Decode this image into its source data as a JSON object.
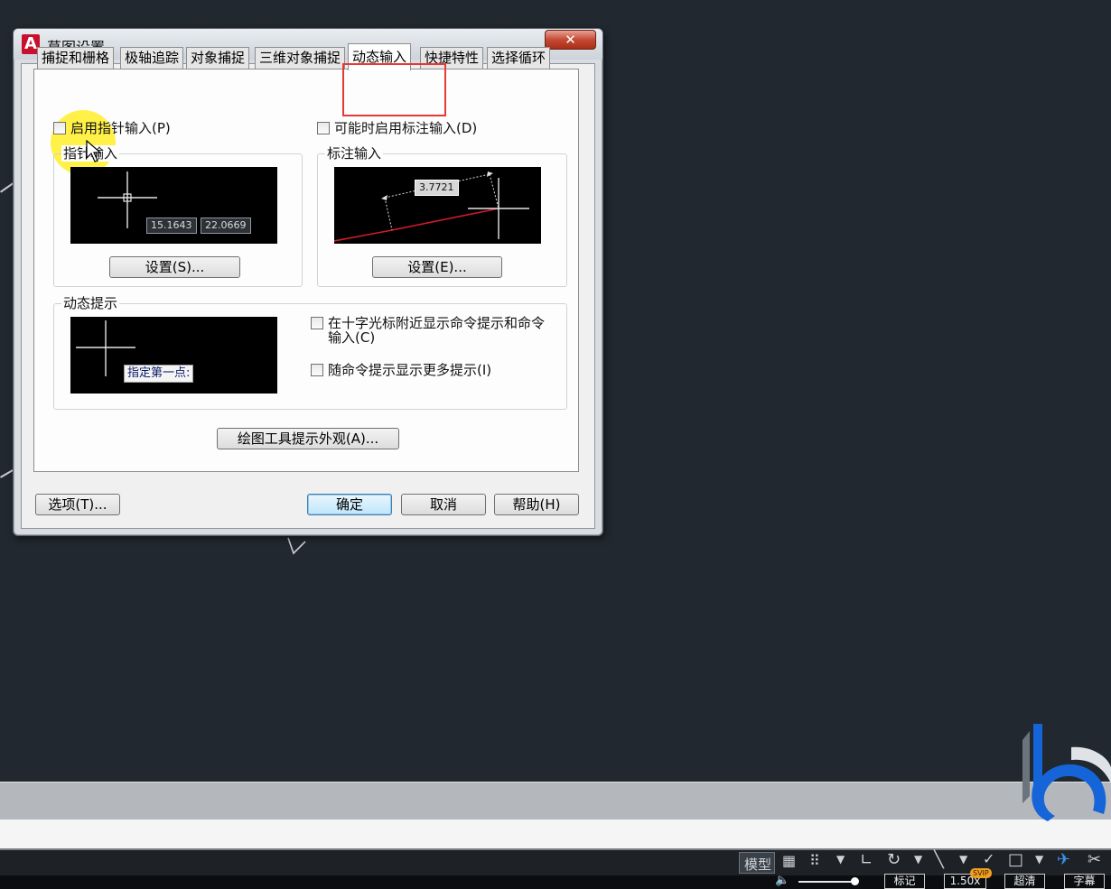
{
  "dialog": {
    "title": "草图设置",
    "close_label": "✕",
    "tabs": [
      {
        "label": "捕捉和栅格"
      },
      {
        "label": "极轴追踪"
      },
      {
        "label": "对象捕捉"
      },
      {
        "label": "三维对象捕捉"
      },
      {
        "label": "动态输入",
        "active": true
      },
      {
        "label": "快捷特性"
      },
      {
        "label": "选择循环"
      }
    ],
    "pointer_input": {
      "enable_label": "启用指针输入(P)",
      "group_label": "指针输入",
      "coord_x": "15.1643",
      "coord_y": "22.0669",
      "settings_button": "设置(S)..."
    },
    "dimension_input": {
      "enable_label": "可能时启用标注输入(D)",
      "group_label": "标注输入",
      "dimension_value": "3.7721",
      "settings_button": "设置(E)..."
    },
    "dynamic_prompts": {
      "group_label": "动态提示",
      "preview_prompt": "指定第一点:",
      "show_prompts_line1": "在十字光标附近显示命令提示和命令",
      "show_prompts_line2": "输入(C)",
      "more_prompts_label": "随命令提示显示更多提示(I)"
    },
    "tooltip_appearance_button": "绘图工具提示外观(A)...",
    "options_button": "选项(T)...",
    "ok_button": "确定",
    "cancel_button": "取消",
    "help_button": "帮助(H)"
  },
  "status_bar": {
    "model_label": "模型"
  },
  "player": {
    "mark_label": "标记",
    "speed_label": "1.50x",
    "vip_badge": "SVIP",
    "quality_label": "超清",
    "subtitle_label": "字幕"
  },
  "colors": {
    "background": "#212830",
    "highlight": "#e53935",
    "dimension_line": "#d11a2a"
  }
}
